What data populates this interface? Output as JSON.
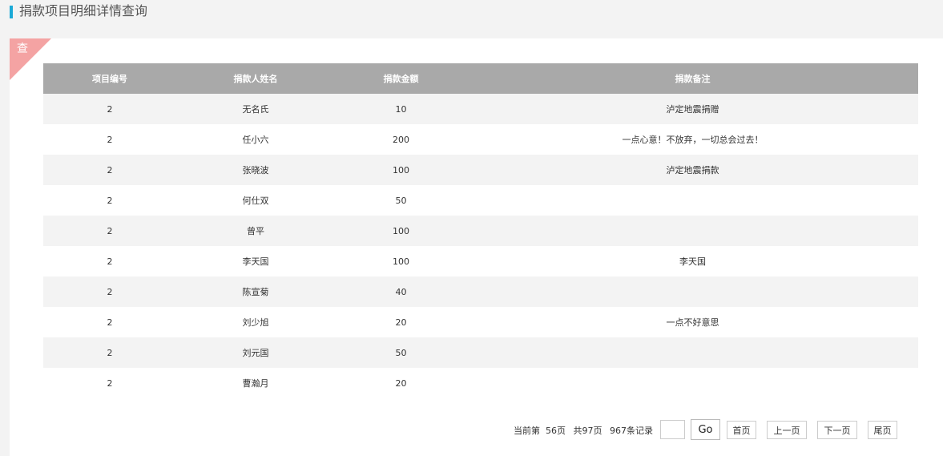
{
  "header": {
    "title": "捐款项目明细详情查询"
  },
  "corner_tag": {
    "label": "查"
  },
  "table": {
    "columns": [
      "项目编号",
      "捐款人姓名",
      "捐款金额",
      "捐款备注"
    ],
    "rows": [
      [
        "2",
        "无名氏",
        "10",
        "泸定地震捐赠"
      ],
      [
        "2",
        "任小六",
        "200",
        "一点心意！不放弃，一切总会过去！"
      ],
      [
        "2",
        "张晓波",
        "100",
        "泸定地震捐款"
      ],
      [
        "2",
        "何仕双",
        "50",
        ""
      ],
      [
        "2",
        "曾平",
        "100",
        ""
      ],
      [
        "2",
        "李天国",
        "100",
        "李天国"
      ],
      [
        "2",
        "陈宣菊",
        "40",
        ""
      ],
      [
        "2",
        "刘少旭",
        "20",
        "一点不好意思"
      ],
      [
        "2",
        "刘元国",
        "50",
        ""
      ],
      [
        "2",
        "曹瀚月",
        "20",
        ""
      ]
    ]
  },
  "pager": {
    "current_page_text": "当前第  56页",
    "total_pages_text": "共97页",
    "total_records_text": "967条记录",
    "page_input_value": "",
    "go_label": "Go",
    "first_label": "首页",
    "prev_label": "上一页",
    "next_label": "下一页",
    "last_label": "尾页"
  },
  "colors": {
    "accent": "#1ba9d6",
    "header_row": "#a9a9a9",
    "corner_tag": "#f4a3a3",
    "stripe": "#f3f3f3"
  }
}
